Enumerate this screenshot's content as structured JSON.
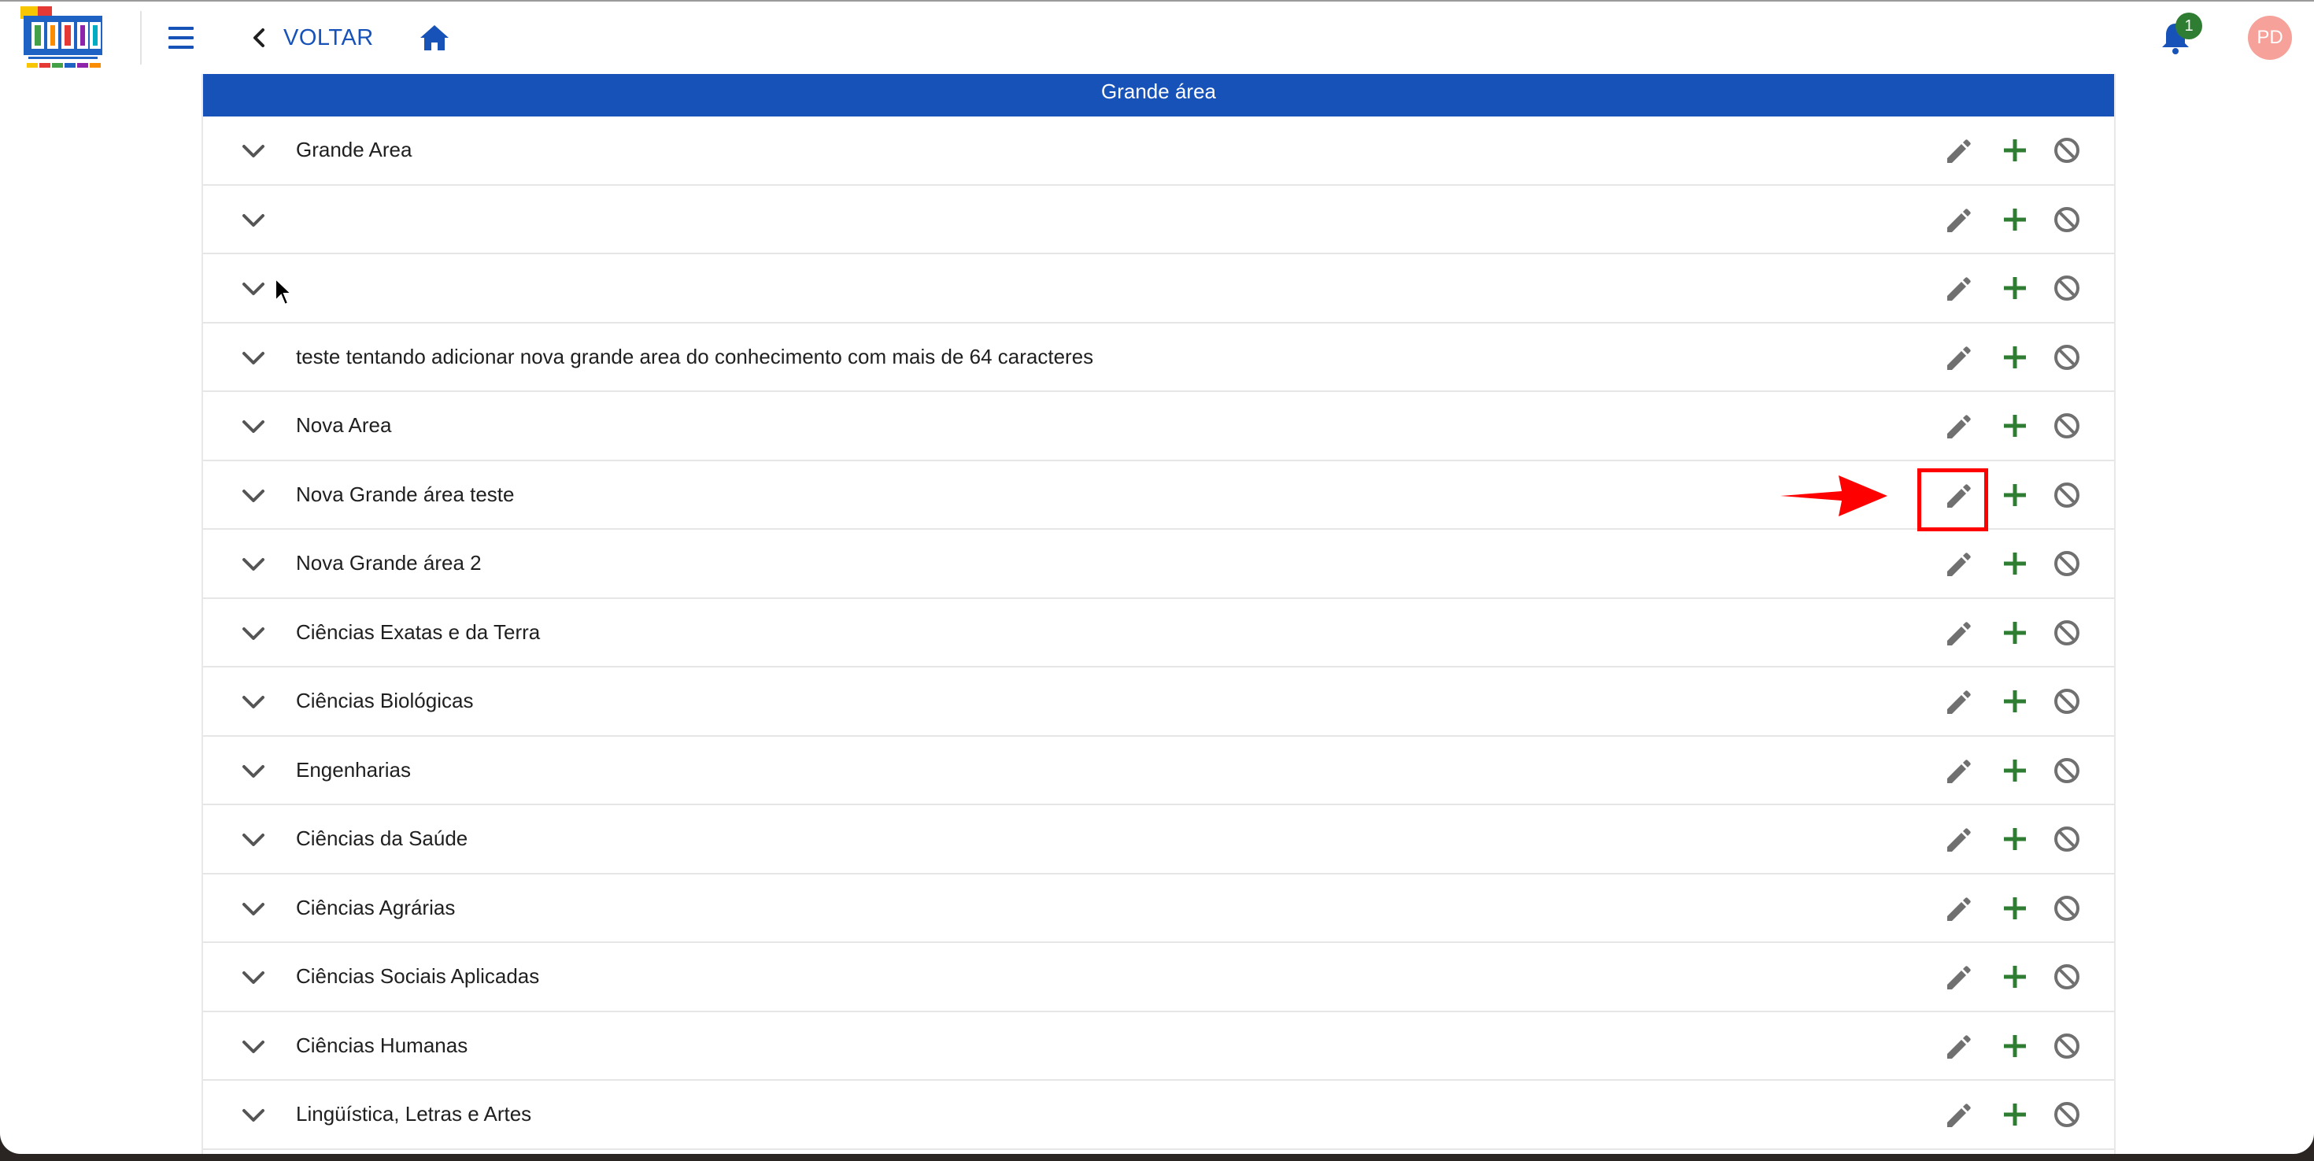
{
  "header": {
    "back_label": "VOLTAR",
    "notification_count": "1",
    "avatar_initials": "PD",
    "icons": [
      "menu-icon",
      "chevron-left-icon",
      "home-icon",
      "bell-icon"
    ]
  },
  "panel": {
    "title": "Grande área",
    "rows": [
      {
        "label": "Grande Area"
      },
      {
        "label": ""
      },
      {
        "label": ""
      },
      {
        "label": "teste tentando adicionar nova grande area do conhecimento com mais de 64 caracteres"
      },
      {
        "label": "Nova Area"
      },
      {
        "label": "Nova Grande área teste"
      },
      {
        "label": "Nova Grande área 2"
      },
      {
        "label": "Ciências Exatas e da Terra"
      },
      {
        "label": "Ciências Biológicas"
      },
      {
        "label": "Engenharias"
      },
      {
        "label": "Ciências da Saúde"
      },
      {
        "label": "Ciências Agrárias"
      },
      {
        "label": "Ciências Sociais Aplicadas"
      },
      {
        "label": "Ciências Humanas"
      },
      {
        "label": "Lingüística, Letras e Artes"
      }
    ]
  },
  "colors": {
    "primary": "#1652b8",
    "add_green": "#2e7d32",
    "icon_gray": "#707070",
    "annotation_red": "#ff0000",
    "badge_green": "#2e7d32",
    "avatar": "#f6a19a"
  },
  "annotation": {
    "highlighted_row": 5,
    "highlighted_action": "edit"
  }
}
